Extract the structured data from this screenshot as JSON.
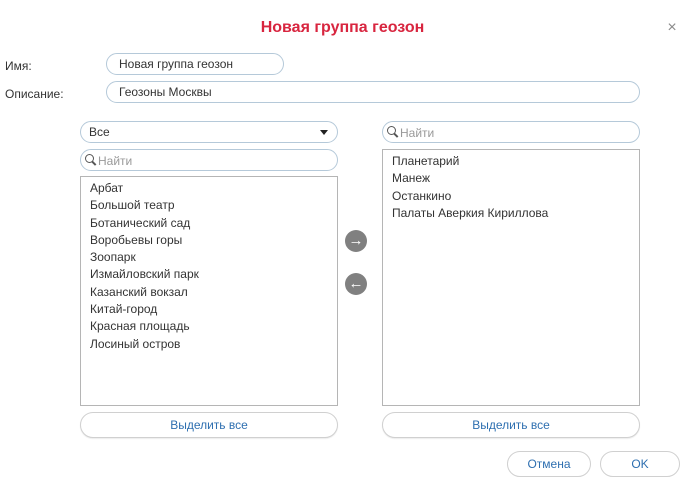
{
  "dialog": {
    "title": "Новая группа геозон",
    "close_icon": "×"
  },
  "form": {
    "name_label": "Имя:",
    "name_value": "Новая группа геозон",
    "description_label": "Описание:",
    "description_value": "Геозоны Москвы"
  },
  "left_panel": {
    "filter_value": "Все",
    "search_placeholder": "Найти",
    "items": [
      "Арбат",
      "Большой театр",
      "Ботанический сад",
      "Воробьевы горы",
      "Зоопарк",
      "Измайловский парк",
      "Казанский вокзал",
      "Китай-город",
      "Красная площадь",
      "Лосиный остров"
    ],
    "select_all_label": "Выделить все"
  },
  "right_panel": {
    "search_placeholder": "Найти",
    "items": [
      "Планетарий",
      "Манеж",
      "Останкино",
      "Палаты Аверкия Кириллова"
    ],
    "select_all_label": "Выделить все"
  },
  "transfer": {
    "add_icon": "→",
    "remove_icon": "←"
  },
  "footer": {
    "cancel_label": "Отмена",
    "ok_label": "OK"
  },
  "colors": {
    "title": "#d8253f",
    "button_text": "#2e6fb0",
    "arrow_button": "#808080",
    "field_border": "#b5c9d9"
  }
}
